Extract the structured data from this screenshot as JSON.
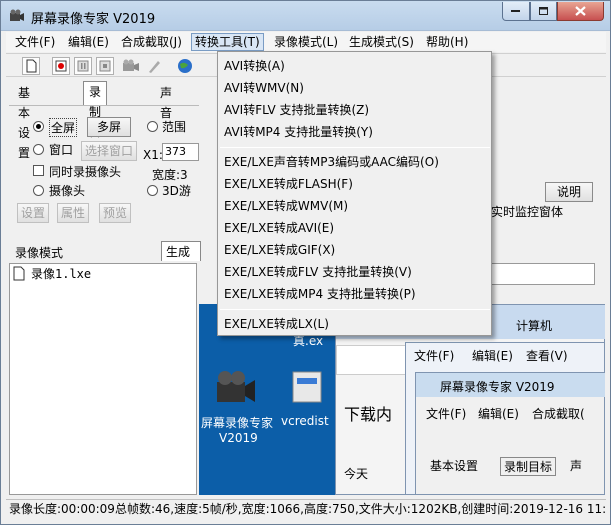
{
  "window": {
    "title": "屏幕录像专家 V2019"
  },
  "menubar": {
    "items": [
      "文件(F)",
      "编辑(E)",
      "合成截取(J)",
      "转换工具(T)",
      "录像模式(L)",
      "生成模式(S)",
      "帮助(H)"
    ],
    "active_index": 3
  },
  "tabs": {
    "items": [
      "基本设置",
      "录制目标",
      "声音"
    ],
    "selected_index": 1
  },
  "record_target": {
    "fullscreen": "全屏",
    "multiscreen": "多屏",
    "range": "范围",
    "window": "窗口",
    "select_window": "选择窗口",
    "x1_label": "X1:",
    "x1_value": "373",
    "sync_camera": "同时录摄像头",
    "width_label": "宽度:3",
    "camera": "摄像头",
    "game_3d": "3D游",
    "settings": "设置",
    "properties": "属性",
    "preview": "预览"
  },
  "right_panel": {
    "explain": "说明",
    "monitor": "实时监控窗体"
  },
  "list": {
    "header": "录像模式",
    "tab_generate": "生成",
    "items": [
      "录像1.lxe"
    ]
  },
  "dropdown": {
    "group1": [
      "AVI转换(A)",
      "AVI转WMV(N)",
      "AVI转FLV 支持批量转换(Z)",
      "AVI转MP4 支持批量转换(Y)"
    ],
    "group2": [
      "EXE/LXE声音转MP3编码或AAC编码(O)",
      "EXE/LXE转成FLASH(F)",
      "EXE/LXE转成WMV(M)",
      "EXE/LXE转成AVI(E)",
      "EXE/LXE转成GIF(X)",
      "EXE/LXE转成FLV 支持批量转换(V)",
      "EXE/LXE转成MP4 支持批量转换(P)"
    ],
    "group3": [
      "EXE/LXE转成LX(L)"
    ]
  },
  "preview": {
    "desktop_icon1_line1": "屏幕录像专家",
    "desktop_icon1_line2": "V2019",
    "desktop_icon2": "vcredist",
    "desktop_icon_top": "真.ex",
    "explorer_path": "计算机",
    "download_text": "下载内",
    "today": "今天",
    "inner_menu": [
      "文件(F)",
      "编辑(E)",
      "查看(V)"
    ],
    "inner_title": "屏幕录像专家 V2019",
    "inner_menu2": [
      "文件(F)",
      "编辑(E)",
      "合成截取("
    ],
    "inner_tabs": [
      "基本设置",
      "录制目标",
      "声"
    ]
  },
  "status": {
    "text": "录像长度:00:00:09总帧数:46,速度:5帧/秒,宽度:1066,高度:750,文件大小:1202KB,创建时间:2019-12-16 11:3"
  },
  "colors": {
    "desktop_blue": "#0c5ea8",
    "close_red": "#c75050"
  }
}
